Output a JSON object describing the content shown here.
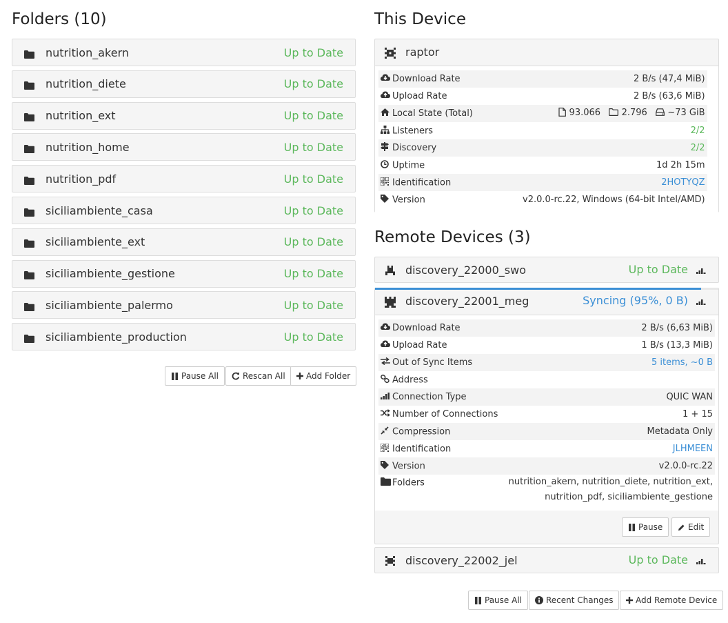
{
  "folders_title": "Folders (10)",
  "folders": [
    {
      "name": "nutrition_akern",
      "status": "Up to Date"
    },
    {
      "name": "nutrition_diete",
      "status": "Up to Date"
    },
    {
      "name": "nutrition_ext",
      "status": "Up to Date"
    },
    {
      "name": "nutrition_home",
      "status": "Up to Date"
    },
    {
      "name": "nutrition_pdf",
      "status": "Up to Date"
    },
    {
      "name": "siciliambiente_casa",
      "status": "Up to Date"
    },
    {
      "name": "siciliambiente_ext",
      "status": "Up to Date"
    },
    {
      "name": "siciliambiente_gestione",
      "status": "Up to Date"
    },
    {
      "name": "siciliambiente_palermo",
      "status": "Up to Date"
    },
    {
      "name": "siciliambiente_production",
      "status": "Up to Date"
    }
  ],
  "folder_buttons": {
    "pause_all": "Pause All",
    "rescan_all": "Rescan All",
    "add_folder": "Add Folder"
  },
  "this_device": {
    "title": "This Device",
    "name": "raptor",
    "rows": [
      {
        "label": "Download Rate",
        "value": "2 B/s (47,4 MiB)"
      },
      {
        "label": "Upload Rate",
        "value": "2 B/s (63,6 MiB)"
      },
      {
        "label": "Local State (Total)",
        "files": "93.066",
        "dirs": "2.796",
        "size": "~73 GiB"
      },
      {
        "label": "Listeners",
        "value": "2/2"
      },
      {
        "label": "Discovery",
        "value": "2/2"
      },
      {
        "label": "Uptime",
        "value": "1d 2h 15m"
      },
      {
        "label": "Identification",
        "value": "2HOTYQZ"
      },
      {
        "label": "Version",
        "value": "v2.0.0-rc.22, Windows (64-bit Intel/AMD)"
      }
    ]
  },
  "remote": {
    "title": "Remote Devices (3)",
    "devices": [
      {
        "name": "discovery_22000_swo",
        "status": "Up to Date"
      },
      {
        "name": "discovery_22001_meg",
        "status": "Syncing (95%, 0 B)"
      },
      {
        "name": "discovery_22002_jel",
        "status": "Up to Date"
      }
    ],
    "sync_progress": 0.95,
    "rows": [
      {
        "label": "Download Rate",
        "value": "2 B/s (6,63 MiB)"
      },
      {
        "label": "Upload Rate",
        "value": "1 B/s (13,3 MiB)"
      },
      {
        "label": "Out of Sync Items",
        "value": "5 items, ~0 B"
      },
      {
        "label": "Address",
        "value": ""
      },
      {
        "label": "Connection Type",
        "value": "QUIC WAN"
      },
      {
        "label": "Number of Connections",
        "value": "1 + 15"
      },
      {
        "label": "Compression",
        "value": "Metadata Only"
      },
      {
        "label": "Identification",
        "value": "JLHMEEN"
      },
      {
        "label": "Version",
        "value": "v2.0.0-rc.22"
      },
      {
        "label": "Folders",
        "value_line1": "nutrition_akern, nutrition_diete, nutrition_ext,",
        "value_line2": "nutrition_pdf, siciliambiente_gestione"
      }
    ],
    "device_buttons": {
      "pause": "Pause",
      "edit": "Edit"
    },
    "buttons": {
      "pause_all": "Pause All",
      "recent_changes": "Recent Changes",
      "add_remote": "Add Remote Device"
    }
  },
  "colors": {
    "up_to_date": "#5cb85c",
    "link": "#3b8fd6"
  }
}
